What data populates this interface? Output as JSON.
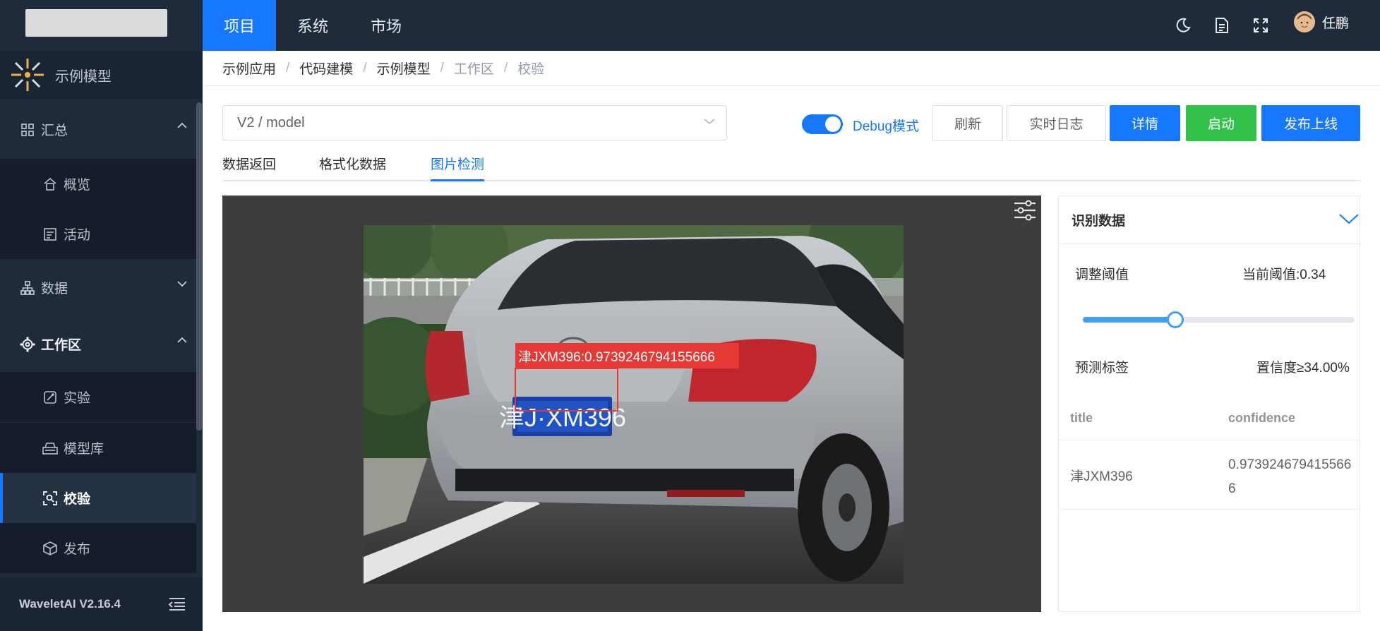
{
  "sidebar": {
    "model_name": "示例模型",
    "menu": {
      "summary": "汇总",
      "overview": "概览",
      "activity": "活动",
      "data": "数据",
      "workspace": "工作区",
      "experiment": "实验",
      "model_library": "模型库",
      "validation": "校验",
      "publish": "发布"
    },
    "version": "WaveletAI V2.16.4"
  },
  "topbar": {
    "tabs": [
      "项目",
      "系统",
      "市场"
    ],
    "active_tab": "项目",
    "user_name": "任鹏"
  },
  "breadcrumb": [
    "示例应用",
    "代码建模",
    "示例模型",
    "工作区",
    "校验"
  ],
  "controls": {
    "version_select": "V2 / model",
    "debug_label": "Debug模式",
    "debug_on": true,
    "buttons": {
      "refresh": "刷新",
      "realtime_log": "实时日志",
      "details": "详情",
      "start": "启动",
      "publish_online": "发布上线"
    }
  },
  "tabs": [
    "数据返回",
    "格式化数据",
    "图片检测"
  ],
  "active_content_tab": "图片检测",
  "detection": {
    "label": "津JXM396:0.9739246794155666",
    "plate_text": "津J·XM396"
  },
  "panel": {
    "title": "识别数据",
    "threshold_label": "调整阈值",
    "threshold_current": "当前阈值:0.34",
    "threshold_value": 0.34,
    "predict_label": "预测标签",
    "confidence_filter": "置信度≥34.00%",
    "columns": [
      "title",
      "confidence"
    ],
    "rows": [
      {
        "title": "津JXM396",
        "confidence": "0.9739246794155666"
      }
    ]
  },
  "colors": {
    "sidebar_bg": "#1f2a3a",
    "accent": "#1677ff",
    "green": "#33c14b",
    "detection_red": "#e53935"
  }
}
